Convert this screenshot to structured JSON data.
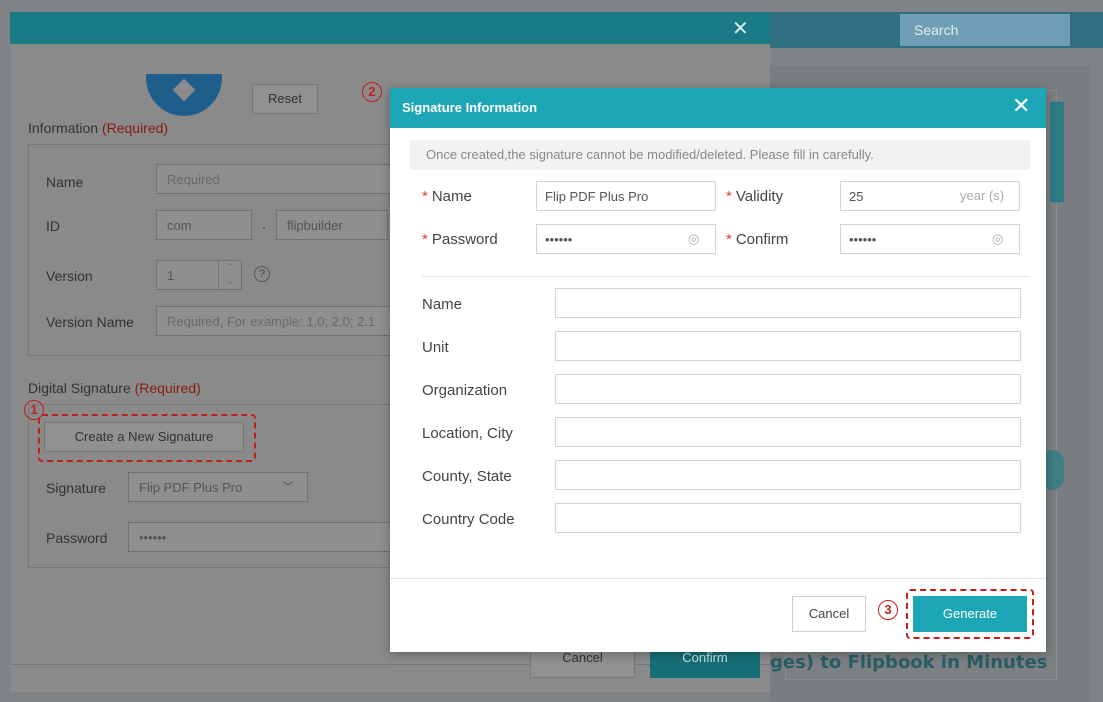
{
  "background": {
    "search_placeholder": "Search",
    "banner_text": "ges) to Flipbook in Minutes"
  },
  "left_dialog": {
    "close_glyph": "✕",
    "reset_label": "Reset",
    "information_title": "Information ",
    "required_tag": "(Required)",
    "fields": {
      "name_label": "Name",
      "name_placeholder": "Required",
      "id_label": "ID",
      "id_part1": "com",
      "id_sep": ".",
      "id_part2": "flipbuilder",
      "version_label": "Version",
      "version_value": "1",
      "version_name_label": "Version Name",
      "version_name_placeholder": "Required, For example: 1.0; 2.0; 2.1"
    },
    "digital_signature_title": "Digital Signature ",
    "create_signature_label": "Create a New Signature",
    "signature_label": "Signature",
    "signature_value": "Flip PDF Plus Pro",
    "password_label": "Password",
    "password_value": "••••••",
    "cancel_label": "Cancel",
    "confirm_label": "Confirm"
  },
  "markers": {
    "one": "1",
    "two": "2",
    "three": "3"
  },
  "modal": {
    "title": "Signature Information",
    "close_glyph": "✕",
    "notice": "Once created,the signature cannot be modified/deleted. Please fill in carefully.",
    "required_star": "*",
    "name_label": "Name",
    "name_value": "Flip PDF Plus Pro",
    "validity_label": "Validity",
    "validity_value": "25",
    "validity_unit": "year (s)",
    "password_label": "Password",
    "password_value": "••••••",
    "confirm_label": "Confirm",
    "confirm_value": "••••••",
    "eye_glyph": "◎",
    "details": [
      {
        "label": "Name",
        "value": ""
      },
      {
        "label": "Unit",
        "value": ""
      },
      {
        "label": "Organization",
        "value": ""
      },
      {
        "label": "Location, City",
        "value": ""
      },
      {
        "label": "County, State",
        "value": ""
      },
      {
        "label": "Country Code",
        "value": ""
      }
    ],
    "cancel_label": "Cancel",
    "generate_label": "Generate"
  },
  "colors": {
    "accent": "#1da6b5",
    "required": "#e23b2f",
    "marker": "#c0211a"
  }
}
